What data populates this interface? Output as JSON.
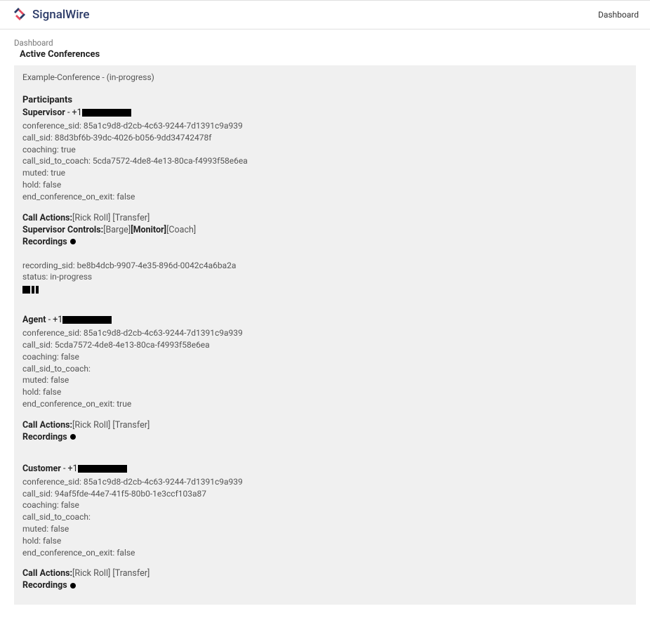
{
  "header": {
    "brand": "SignalWire",
    "nav_dashboard": "Dashboard"
  },
  "breadcrumb": "Dashboard",
  "page_title": "Active Conferences",
  "conference": {
    "name": "Example-Conference",
    "status": "(in-progress)"
  },
  "labels": {
    "participants": "Participants",
    "call_actions": "Call Actions:",
    "supervisor_controls": "Supervisor Controls:",
    "recordings": "Recordings",
    "conference_sid": "conference_sid:",
    "call_sid": "call_sid:",
    "coaching": "coaching:",
    "call_sid_to_coach": "call_sid_to_coach:",
    "muted": "muted:",
    "hold": "hold:",
    "end_conference_on_exit": "end_conference_on_exit:",
    "recording_sid": "recording_sid:",
    "status": "status:"
  },
  "call_actions": {
    "rick_roll": "[Rick Roll]",
    "transfer": "[Transfer]"
  },
  "supervisor_controls": {
    "barge": "[Barge]",
    "monitor": "[Monitor]",
    "coach": "[Coach]"
  },
  "participants": [
    {
      "role": "Supervisor",
      "phone_prefix": "+1",
      "conference_sid": "85a1c9d8-d2cb-4c63-9244-7d1391c9a939",
      "call_sid": "88d3bf6b-39dc-4026-b056-9dd34742478f",
      "coaching": "true",
      "call_sid_to_coach": "5cda7572-4de8-4e13-80ca-f4993f58e6ea",
      "muted": "true",
      "hold": "false",
      "end_conference_on_exit": "false",
      "has_supervisor_controls": true,
      "supervisor_active": "monitor",
      "recording": {
        "recording_sid": "be8b4dcb-9907-4e35-896d-0042c4a6ba2a",
        "status": "in-progress"
      }
    },
    {
      "role": "Agent",
      "phone_prefix": "+1",
      "conference_sid": "85a1c9d8-d2cb-4c63-9244-7d1391c9a939",
      "call_sid": "5cda7572-4de8-4e13-80ca-f4993f58e6ea",
      "coaching": "false",
      "call_sid_to_coach": "",
      "muted": "false",
      "hold": "false",
      "end_conference_on_exit": "true",
      "has_supervisor_controls": false
    },
    {
      "role": "Customer",
      "phone_prefix": "+1",
      "conference_sid": "85a1c9d8-d2cb-4c63-9244-7d1391c9a939",
      "call_sid": "94af5fde-44e7-41f5-80b0-1e3ccf103a87",
      "coaching": "false",
      "call_sid_to_coach": "",
      "muted": "false",
      "hold": "false",
      "end_conference_on_exit": "false",
      "has_supervisor_controls": false
    }
  ]
}
